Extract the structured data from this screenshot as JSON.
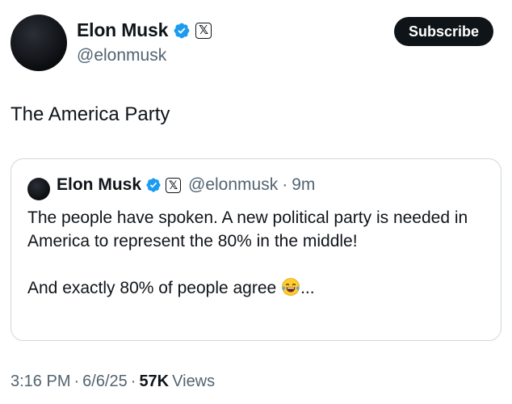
{
  "author": {
    "display_name": "Elon Musk",
    "handle": "@elonmusk",
    "verified_icon": "verified-badge-icon",
    "affiliation_icon": "x-logo-icon"
  },
  "subscribe_label": "Subscribe",
  "post": {
    "text": "The America Party"
  },
  "quoted_post": {
    "display_name": "Elon Musk",
    "handle": "@elonmusk",
    "separator": "·",
    "time": "9m",
    "line1": "The people have spoken. A new political party is needed in America to represent the 80% in the middle!",
    "line2_text": "And exactly 80% of people agree",
    "line2_suffix": "...",
    "emoji_icon": "laughing-tears-emoji-icon"
  },
  "meta": {
    "time": "3:16 PM",
    "sep1": "·",
    "date": "6/6/25",
    "sep2": "·",
    "views_count": "57K",
    "views_label": "Views"
  },
  "colors": {
    "text": "#0f1419",
    "secondary": "#536471",
    "verified": "#1d9bf0",
    "border": "#cfd9de"
  }
}
